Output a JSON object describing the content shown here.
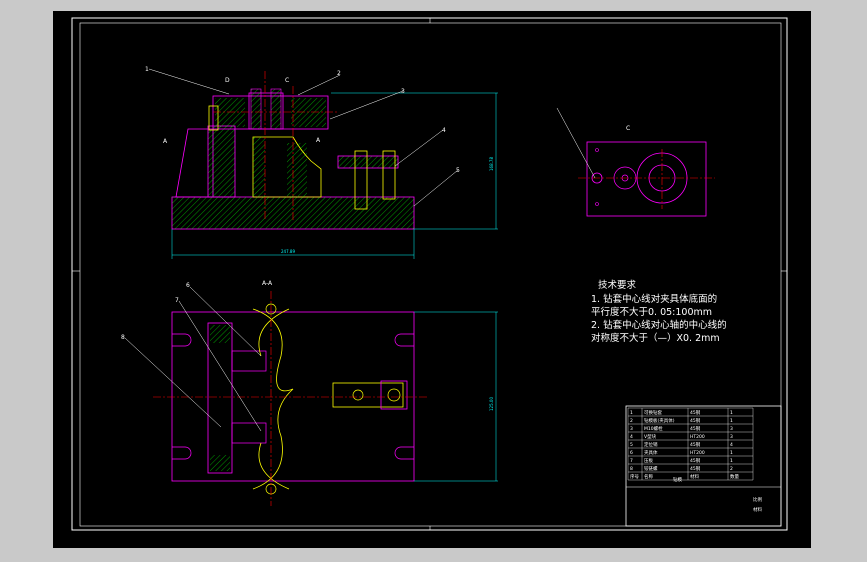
{
  "colors": {
    "frame": "#ffffff",
    "part": "#ff00ff",
    "hatch": "#00ff00",
    "center": "#ff0000",
    "dimension": "#00ffff",
    "accent": "#ffff00",
    "leader": "#ffffff",
    "background": "#000000"
  },
  "views": {
    "front": {
      "section_a_label": "A",
      "section_c_label": "C",
      "section_a_right_label": "A",
      "view_d_label": "D"
    },
    "plan": {
      "section_label": "A-A"
    },
    "side": {
      "view_label": "C"
    }
  },
  "dimensions": {
    "overall_width": "247.89",
    "overall_height": "168.78",
    "plan_depth": "125.00"
  },
  "leaders": [
    "1",
    "2",
    "3",
    "4",
    "5",
    "6",
    "7",
    "8"
  ],
  "tech_requirements": {
    "title": "技术要求",
    "lines": [
      "1. 钻套中心线对夹具体底面的",
      "平行度不大于0. 05:100mm",
      "2. 钻套中心线对心轴的中心线的",
      "对称度不大于（—）Χ0. 2mm"
    ]
  },
  "title_block": {
    "parts_rows": [
      [
        "1",
        "可换钻套",
        "45钢",
        "1"
      ],
      [
        "2",
        "钻模板(夹具体)",
        "45钢",
        "1"
      ],
      [
        "3",
        "M10螺栓",
        "45钢",
        "3"
      ],
      [
        "4",
        "V型块",
        "HT200",
        "3"
      ],
      [
        "5",
        "定位销",
        "45钢",
        "4"
      ],
      [
        "6",
        "夹具体",
        "HT200",
        "1"
      ],
      [
        "7",
        "压板",
        "45钢",
        "1"
      ],
      [
        "8",
        "铰链螺",
        "45钢",
        "2"
      ]
    ],
    "header": [
      "序号",
      "名称",
      "材料",
      "数量"
    ],
    "drawing_name": "钻模",
    "scale_label": "比例",
    "material_label": "材料"
  }
}
